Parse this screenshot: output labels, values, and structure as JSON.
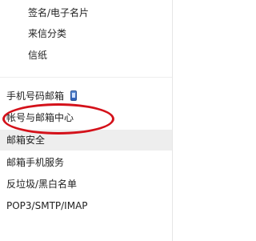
{
  "menu": {
    "sub_items": [
      {
        "label": "签名/电子名片"
      },
      {
        "label": "来信分类"
      },
      {
        "label": "信纸"
      }
    ],
    "items": [
      {
        "label": "手机号码邮箱",
        "icon": "mobile-phone-icon"
      },
      {
        "label": "帐号与邮箱中心"
      },
      {
        "label": "邮箱安全"
      },
      {
        "label": "邮箱手机服务"
      },
      {
        "label": "反垃圾/黑白名单"
      },
      {
        "label": "POP3/SMTP/IMAP"
      }
    ]
  },
  "annotation": {
    "color": "#d4111a"
  },
  "colors": {
    "hover_background": "#eeeeee",
    "text": "#222222"
  }
}
